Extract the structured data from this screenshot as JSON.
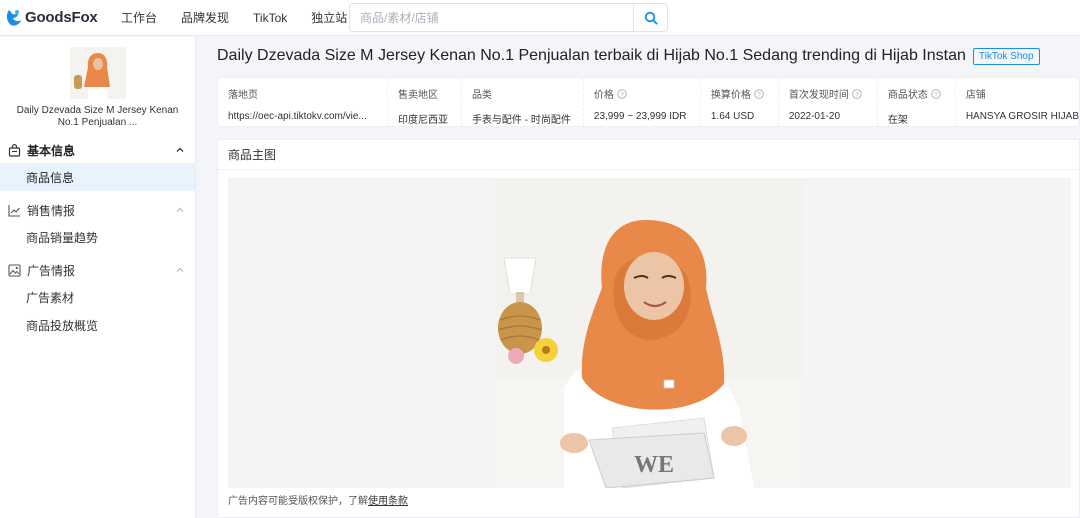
{
  "brand": {
    "name": "GoodsFox"
  },
  "nav": [
    "工作台",
    "品牌发现",
    "TikTok",
    "独立站"
  ],
  "search": {
    "placeholder": "商品/素材/店铺"
  },
  "sidebar": {
    "product_title": "Daily Dzevada Size M Jersey Kenan No.1 Penjualan ...",
    "sections": [
      {
        "label": "基本信息",
        "items": [
          "商品信息"
        ]
      },
      {
        "label": "销售情报",
        "items": [
          "商品销量趋势"
        ]
      },
      {
        "label": "广告情报",
        "items": [
          "广告素材",
          "商品投放概览"
        ]
      }
    ]
  },
  "product": {
    "title": "Daily Dzevada Size M Jersey Kenan No.1 Penjualan terbaik di Hijab No.1 Sedang trending di Hijab Instan",
    "badge": "TikTok Shop",
    "info": [
      {
        "label": "落地页",
        "value": "https://oec-api.tiktokv.com/vie..."
      },
      {
        "label": "售卖地区",
        "value": "印度尼西亚"
      },
      {
        "label": "品类",
        "value": "手表与配件 - 时尚配件"
      },
      {
        "label": "价格",
        "value": "23,999 ~ 23,999 IDR"
      },
      {
        "label": "换算价格",
        "value": "1.64 USD"
      },
      {
        "label": "首次发现时间",
        "value": "2022-01-20"
      },
      {
        "label": "商品状态",
        "value": "在架"
      },
      {
        "label": "店铺",
        "value": "HANSYA GROSIR HIJAB"
      }
    ]
  },
  "main_image": {
    "heading": "商品主图",
    "disclaimer": "广告内容可能受版权保护，了解",
    "terms_link": "使用条款"
  },
  "colors": {
    "accent": "#1a8fe3",
    "hijab": "#e8894a",
    "active_bg": "#e8f3fd"
  }
}
